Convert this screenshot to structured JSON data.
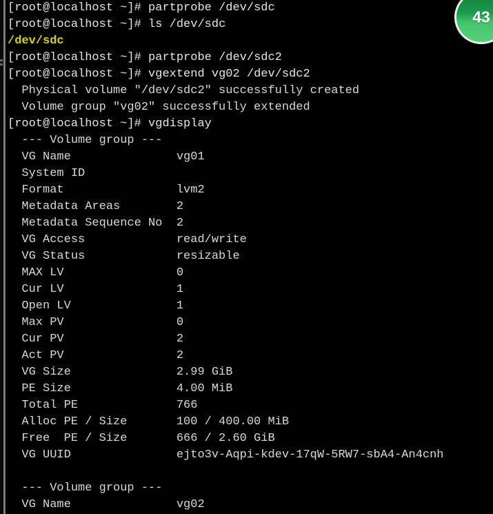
{
  "terminal": {
    "prompt": "[root@localhost ~]#",
    "colors": {
      "background": "#000000",
      "foreground": "#d8d8d8",
      "bold_yellow": "#d7d700",
      "border_strip": "#9fb6b3",
      "badge_green": "#1d9c4f",
      "badge_border": "#eaf6ee"
    },
    "lines": [
      {
        "type": "command",
        "prompt": "[root@localhost ~]# ",
        "text": "partprobe /dev/sdc"
      },
      {
        "type": "command",
        "prompt": "[root@localhost ~]# ",
        "text": "ls /dev/sdc"
      },
      {
        "type": "output-yellow",
        "text": "/dev/sdc"
      },
      {
        "type": "command",
        "prompt": "[root@localhost ~]# ",
        "text": "partprobe /dev/sdc2"
      },
      {
        "type": "command",
        "prompt": "[root@localhost ~]# ",
        "text": "vgextend vg02 /dev/sdc2"
      },
      {
        "type": "output",
        "text": "  Physical volume \"/dev/sdc2\" successfully created"
      },
      {
        "type": "output",
        "text": "  Volume group \"vg02\" successfully extended"
      },
      {
        "type": "command",
        "prompt": "[root@localhost ~]# ",
        "text": "vgdisplay"
      },
      {
        "type": "output",
        "text": "  --- Volume group ---"
      },
      {
        "type": "output",
        "text": "  VG Name               vg01"
      },
      {
        "type": "output",
        "text": "  System ID"
      },
      {
        "type": "output",
        "text": "  Format                lvm2"
      },
      {
        "type": "output",
        "text": "  Metadata Areas        2"
      },
      {
        "type": "output",
        "text": "  Metadata Sequence No  2"
      },
      {
        "type": "output",
        "text": "  VG Access             read/write"
      },
      {
        "type": "output",
        "text": "  VG Status             resizable"
      },
      {
        "type": "output",
        "text": "  MAX LV                0"
      },
      {
        "type": "output",
        "text": "  Cur LV                1"
      },
      {
        "type": "output",
        "text": "  Open LV               1"
      },
      {
        "type": "output",
        "text": "  Max PV                0"
      },
      {
        "type": "output",
        "text": "  Cur PV                2"
      },
      {
        "type": "output",
        "text": "  Act PV                2"
      },
      {
        "type": "output",
        "text": "  VG Size               2.99 GiB"
      },
      {
        "type": "output",
        "text": "  PE Size               4.00 MiB"
      },
      {
        "type": "output",
        "text": "  Total PE              766"
      },
      {
        "type": "output",
        "text": "  Alloc PE / Size       100 / 400.00 MiB"
      },
      {
        "type": "output",
        "text": "  Free  PE / Size       666 / 2.60 GiB"
      },
      {
        "type": "output",
        "text": "  VG UUID               ejto3v-Aqpi-kdev-17qW-5RW7-sbA4-An4cnh"
      },
      {
        "type": "blank",
        "text": ""
      },
      {
        "type": "output",
        "text": "  --- Volume group ---"
      },
      {
        "type": "output",
        "text": "  VG Name               vg02"
      }
    ],
    "vgdisplay": {
      "vg01": {
        "header": "--- Volume group ---",
        "VG Name": "vg01",
        "System ID": "",
        "Format": "lvm2",
        "Metadata Areas": "2",
        "Metadata Sequence No": "2",
        "VG Access": "read/write",
        "VG Status": "resizable",
        "MAX LV": "0",
        "Cur LV": "1",
        "Open LV": "1",
        "Max PV": "0",
        "Cur PV": "2",
        "Act PV": "2",
        "VG Size": "2.99 GiB",
        "PE Size": "4.00 MiB",
        "Total PE": "766",
        "Alloc PE / Size": "100 / 400.00 MiB",
        "Free  PE / Size": "666 / 2.60 GiB",
        "VG UUID": "ejto3v-Aqpi-kdev-17qW-5RW7-sbA4-An4cnh"
      },
      "vg02": {
        "header": "--- Volume group ---",
        "VG Name": "vg02"
      }
    }
  },
  "badge": {
    "label": "43"
  }
}
